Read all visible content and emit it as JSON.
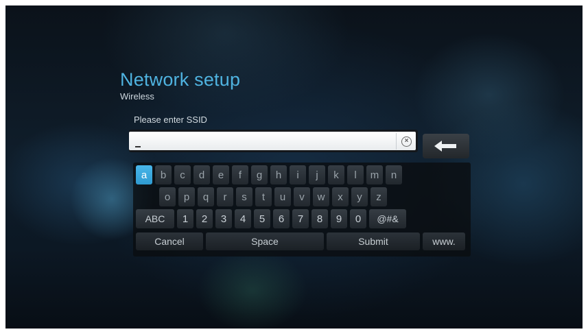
{
  "header": {
    "title": "Network setup",
    "subtitle": "Wireless"
  },
  "ssid": {
    "prompt": "Please enter SSID",
    "value": "",
    "cursor_glyph": "_",
    "clear_icon": "clear-circle-x-icon",
    "backspace_icon": "backspace-arrow-icon"
  },
  "keyboard": {
    "selected_key": "a",
    "row1": [
      "a",
      "b",
      "c",
      "d",
      "e",
      "f",
      "g",
      "h",
      "i",
      "j",
      "k",
      "l",
      "m",
      "n"
    ],
    "row2": [
      "o",
      "p",
      "q",
      "r",
      "s",
      "t",
      "u",
      "v",
      "w",
      "x",
      "y",
      "z"
    ],
    "row3_mode": "ABC",
    "row3_digits": [
      "1",
      "2",
      "3",
      "4",
      "5",
      "6",
      "7",
      "8",
      "9",
      "0"
    ],
    "row3_symbols": "@#&",
    "row4": {
      "cancel": "Cancel",
      "space": "Space",
      "submit": "Submit",
      "www": "www."
    }
  },
  "colors": {
    "title": "#4fb3e0",
    "selected_key": "#3aa8de",
    "key_text": "#9aa3aa"
  }
}
